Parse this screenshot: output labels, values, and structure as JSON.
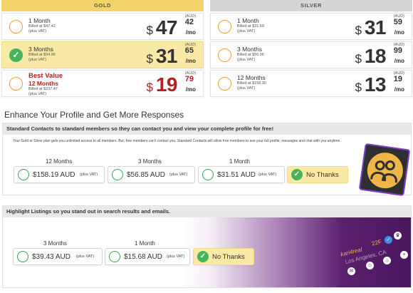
{
  "plans": {
    "gold": {
      "header": "GOLD",
      "rows": [
        {
          "term": "1 Month",
          "billed": "Billed at $47.42",
          "vat": "(plus VAT)",
          "currency": "$",
          "price_int": "47",
          "price_cents": "42",
          "aud": "(AUD)",
          "per": "/mo",
          "selected": false
        },
        {
          "term": "3 Months",
          "billed": "Billed at $94.96",
          "vat": "(plus VAT)",
          "currency": "$",
          "price_int": "31",
          "price_cents": "65",
          "aud": "(AUD)",
          "per": "/mo",
          "selected": true
        },
        {
          "best_label": "Best Value",
          "term": "12 Months",
          "billed": "Billed at $237.47",
          "vat": "(plus VAT)",
          "currency": "$",
          "price_int": "19",
          "price_cents": "79",
          "aud": "(AUD)",
          "per": "/mo",
          "selected": false
        }
      ]
    },
    "silver": {
      "header": "SILVER",
      "rows": [
        {
          "term": "1 Month",
          "billed": "Billed at $31.59",
          "vat": "(plus VAT)",
          "currency": "$",
          "price_int": "31",
          "price_cents": "59",
          "aud": "(AUD)",
          "per": "/mo",
          "selected": false
        },
        {
          "term": "3 Months",
          "billed": "Billed at $56.96",
          "vat": "(plus VAT)",
          "currency": "$",
          "price_int": "18",
          "price_cents": "99",
          "aud": "(AUD)",
          "per": "/mo",
          "selected": false
        },
        {
          "term": "12 Months",
          "billed": "Billed at $158.30",
          "vat": "(plus VAT)",
          "currency": "$",
          "price_int": "13",
          "price_cents": "19",
          "aud": "(AUD)",
          "per": "/mo",
          "selected": false
        }
      ]
    }
  },
  "enhance": {
    "title": "Enhance Your Profile and Get More Responses",
    "contacts": {
      "heading": "Standard Contacts to standard members so they can contact you and view your complete profile for free!",
      "description": "Your Gold or Silver plan gets you unlimited access to all members. But, free members can't contact you. Standard Contacts will allow free members to see your full profile, messages and chat with you anytime.",
      "options": [
        {
          "term": "12 Months",
          "amount": "$158.19 AUD",
          "vat": "(plus VAT)"
        },
        {
          "term": "3 Months",
          "amount": "$56.85 AUD",
          "vat": "(plus VAT)"
        },
        {
          "term": "1 Month",
          "amount": "$31.51 AUD",
          "vat": "(plus VAT)"
        }
      ],
      "no_thanks": "No Thanks"
    },
    "highlight": {
      "heading": "Highlight Listings so you stand out in search results and emails.",
      "options": [
        {
          "term": "3 Months",
          "amount": "$39.43 AUD",
          "vat": "(plus VAT)"
        },
        {
          "term": "1 Month",
          "amount": "$15.68 AUD",
          "vat": "(plus VAT)"
        }
      ],
      "no_thanks": "No Thanks",
      "banner": {
        "username": "kari4real",
        "age": "22F",
        "location": "Los Angeles, CA"
      }
    }
  },
  "colors": {
    "gold": "#f5d36b",
    "silver": "#d6d6d6",
    "selected_bg": "#fbe9a7",
    "green": "#47b35a",
    "best_red": "#b02121",
    "purple": "#4a175e"
  }
}
